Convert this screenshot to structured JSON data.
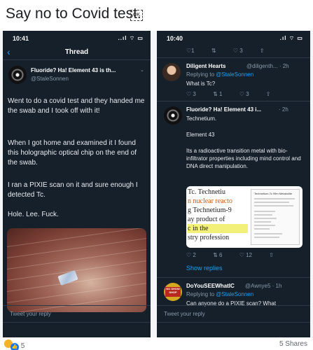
{
  "post": {
    "title": "Say no to Covid test.",
    "title_icon": "OK"
  },
  "left": {
    "status_time": "10:41",
    "status_icons": "..ıl ⌔ ▭",
    "nav_title": "Thread",
    "tweet": {
      "name": "Fluoride? Ha! Element 43 is th...",
      "handle": "@StaleSonnen",
      "p1": "Went to do a covid test and they handed me the swab and I took off with it!",
      "p2": "When I got home and examined it I found this holographic optical chip on the end of the swab.",
      "p3": "I ran a PIXIE scan on it and sure enough I detected Tc.",
      "p4": "Hole. Lee. Fuck."
    },
    "reply_placeholder": "Tweet your reply"
  },
  "right": {
    "status_time": "10:40",
    "status_icons": ".ıl ⌔ ▭",
    "top_actions": [
      "♡1",
      "⇅",
      "♡ 3",
      "⇧"
    ],
    "reply1": {
      "name": "Diligent Hearts",
      "handle_time": "@diligenth... · 2h",
      "replying_prefix": "Replying to ",
      "replying_to": "@StaleSonnen",
      "text": "What is Tc?",
      "actions": [
        "♡ 3",
        "⇅ 1",
        "♡ 3",
        "⇧"
      ]
    },
    "reply2": {
      "name": "Fluoride? Ha! Element 43 i...",
      "handle_time": "· 2h",
      "l1": "Technetium.",
      "l2": "Element 43",
      "l3": "Its a radioactive transition metal with bio-infiltrator properties including mind control and DNA direct manipulation.",
      "image_words": [
        "Tc. Technetiu",
        "n nuclear reacto",
        "g Technetium-9",
        "ay product of",
        "c in the",
        "stry profession"
      ],
      "image_doc_title": "Technetium-Tc 99m Metabolite",
      "actions": [
        "♡ 2",
        "⇅ 6",
        "♡ 12",
        "⇧"
      ],
      "show_replies": "Show replies"
    },
    "reply3": {
      "name": "DoYouSEEWhatIC",
      "handle_time": "@Awnye5 · 1h",
      "avatar_text": "NO SHOW SHOP",
      "replying_prefix": "Replying to ",
      "replying_to": "@StaleSonnen",
      "text": "Can anyone do a PIXIE scan? What"
    },
    "reply_placeholder": "Tweet your reply"
  },
  "footer": {
    "reaction_count": "5",
    "shares": "5 Shares"
  }
}
